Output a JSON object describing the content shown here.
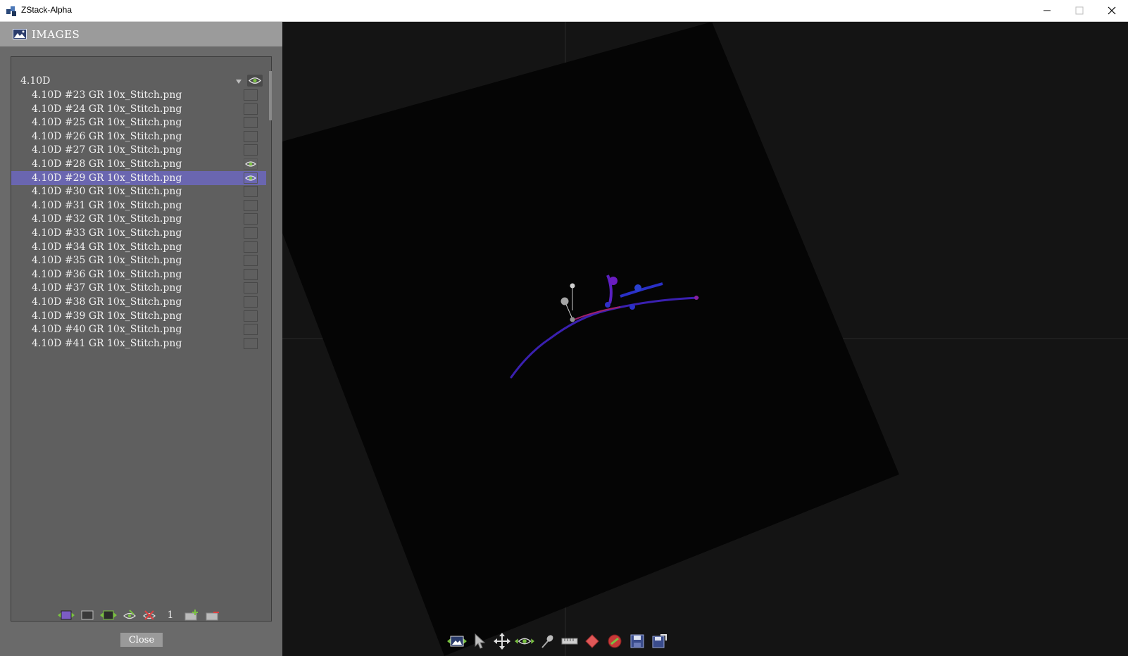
{
  "window": {
    "title": "ZStack-Alpha",
    "controls": [
      "minimize-icon",
      "maximize-icon",
      "close-icon"
    ]
  },
  "panel": {
    "header_icon": "image-icon",
    "header_label": "IMAGES",
    "group": {
      "label": "4.10D",
      "visible": true
    },
    "items": [
      {
        "label": "4.10D #23 GR 10x_Stitch.png",
        "visible": false,
        "selected": false
      },
      {
        "label": "4.10D #24 GR 10x_Stitch.png",
        "visible": false,
        "selected": false
      },
      {
        "label": "4.10D #25 GR 10x_Stitch.png",
        "visible": false,
        "selected": false
      },
      {
        "label": "4.10D #26 GR 10x_Stitch.png",
        "visible": false,
        "selected": false
      },
      {
        "label": "4.10D #27 GR 10x_Stitch.png",
        "visible": false,
        "selected": false
      },
      {
        "label": "4.10D #28 GR 10x_Stitch.png",
        "visible": true,
        "selected": false
      },
      {
        "label": "4.10D #29 GR 10x_Stitch.png",
        "visible": true,
        "selected": true
      },
      {
        "label": "4.10D #30 GR 10x_Stitch.png",
        "visible": false,
        "selected": false
      },
      {
        "label": "4.10D #31 GR 10x_Stitch.png",
        "visible": false,
        "selected": false
      },
      {
        "label": "4.10D #32 GR 10x_Stitch.png",
        "visible": false,
        "selected": false
      },
      {
        "label": "4.10D #33 GR 10x_Stitch.png",
        "visible": false,
        "selected": false
      },
      {
        "label": "4.10D #34 GR 10x_Stitch.png",
        "visible": false,
        "selected": false
      },
      {
        "label": "4.10D #35 GR 10x_Stitch.png",
        "visible": false,
        "selected": false
      },
      {
        "label": "4.10D #36 GR 10x_Stitch.png",
        "visible": false,
        "selected": false
      },
      {
        "label": "4.10D #37 GR 10x_Stitch.png",
        "visible": false,
        "selected": false
      },
      {
        "label": "4.10D #38 GR 10x_Stitch.png",
        "visible": false,
        "selected": false
      },
      {
        "label": "4.10D #39 GR 10x_Stitch.png",
        "visible": false,
        "selected": false
      },
      {
        "label": "4.10D #40 GR 10x_Stitch.png",
        "visible": false,
        "selected": false
      },
      {
        "label": "4.10D #41 GR 10x_Stitch.png",
        "visible": false,
        "selected": false
      }
    ],
    "bottom_icons": [
      "show-all-icon",
      "hide-frame-icon",
      "show-frame-icon",
      "eye-edit-icon",
      "hide-all-icon",
      "number-icon",
      "add-folder-icon",
      "remove-folder-icon"
    ],
    "number_icon_text": "1",
    "close_label": "Close"
  },
  "viewer": {
    "toolbar_icons": [
      "images-tool-icon",
      "pointer-icon",
      "move-icon",
      "visibility-icon",
      "pin-icon",
      "ruler-icon",
      "diamond-marker-icon",
      "no-entry-icon",
      "save-icon",
      "export-icon"
    ]
  },
  "colors": {
    "selection": "#6a66b0",
    "panel_bg": "#6a6a6a",
    "viewer_bg": "#141414",
    "eye_green": "#7ac142"
  }
}
